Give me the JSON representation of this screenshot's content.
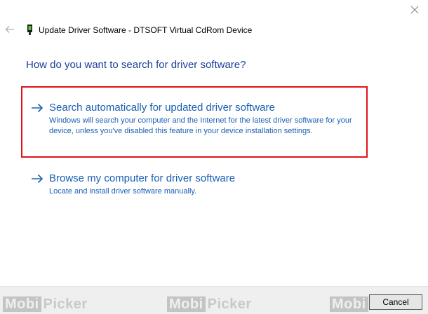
{
  "window": {
    "title": "Update Driver Software - DTSOFT Virtual CdRom Device"
  },
  "heading": "How do you want to search for driver software?",
  "options": [
    {
      "title": "Search automatically for updated driver software",
      "description": "Windows will search your computer and the Internet for the latest driver software for your device, unless you've disabled this feature in your device installation settings."
    },
    {
      "title": "Browse my computer for driver software",
      "description": "Locate and install driver software manually."
    }
  ],
  "footer": {
    "cancel_label": "Cancel",
    "watermark_box": "Mobi",
    "watermark_text": "Picker"
  },
  "colors": {
    "link": "#1a5fb4",
    "heading": "#1a3f9c",
    "highlight": "#e1121b"
  },
  "icons": {
    "close": "close-icon",
    "back": "back-arrow-icon",
    "device": "device-icon",
    "option_arrow": "arrow-right-icon"
  }
}
